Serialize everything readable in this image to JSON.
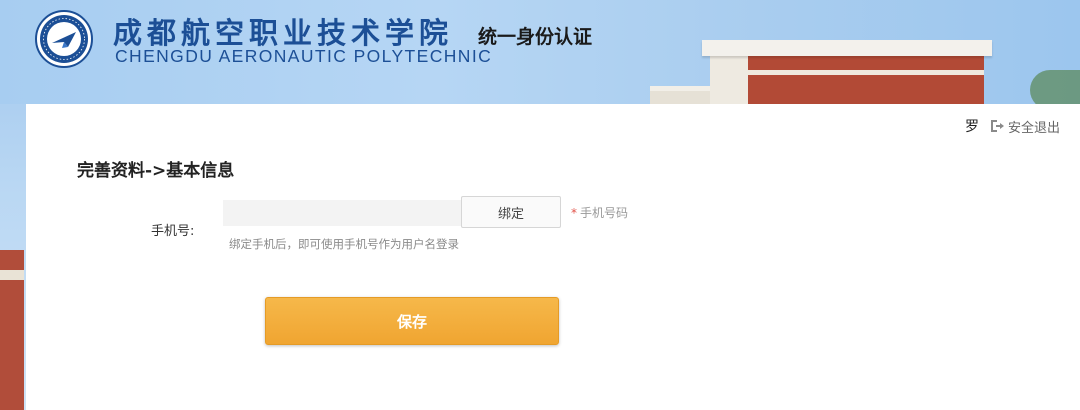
{
  "header": {
    "school_name_cn": "成都航空职业技术学院",
    "school_name_en": "CHENGDU AERONAUTIC POLYTECHNIC",
    "system_title": "统一身份认证",
    "logo_icon": "school-emblem-icon"
  },
  "user": {
    "name": "罗",
    "logout_label": "安全退出",
    "logout_icon": "logout-icon"
  },
  "page": {
    "section_title": "完善资料->基本信息"
  },
  "form": {
    "phone_label": "手机号:",
    "phone_value": "",
    "phone_placeholder": "",
    "bind_label": "绑定",
    "required_star": "*",
    "required_hint": "手机号码",
    "help_text": "绑定手机后，即可使用手机号作为用户名登录",
    "save_label": "保存"
  },
  "colors": {
    "brand_blue": "#1c4f96",
    "save_orange": "#f0a531",
    "required_red": "#e2534a"
  }
}
